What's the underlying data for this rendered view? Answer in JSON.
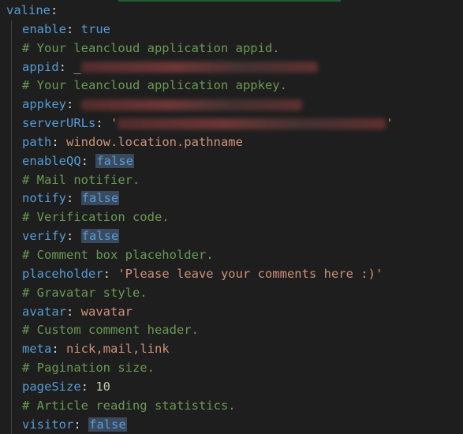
{
  "root_key": "valine",
  "lines": [
    {
      "kind": "kv",
      "key": "enable",
      "value": "true",
      "vtype": "bool"
    },
    {
      "kind": "comment",
      "text": "# Your leancloud application appid."
    },
    {
      "kind": "kv",
      "key": "appid",
      "value": "_",
      "vtype": "redacted"
    },
    {
      "kind": "comment",
      "text": "# Your leancloud application appkey."
    },
    {
      "kind": "kv",
      "key": "appkey",
      "value": "",
      "vtype": "redacted"
    },
    {
      "kind": "kv",
      "key": "serverURLs",
      "value": "''",
      "vtype": "redacted-string"
    },
    {
      "kind": "kv",
      "key": "path",
      "value": "window.location.pathname",
      "vtype": "string"
    },
    {
      "kind": "kv",
      "key": "enableQQ",
      "value": "false",
      "vtype": "bool-hl"
    },
    {
      "kind": "comment",
      "text": "# Mail notifier."
    },
    {
      "kind": "kv",
      "key": "notify",
      "value": "false",
      "vtype": "bool-hl"
    },
    {
      "kind": "comment",
      "text": "# Verification code."
    },
    {
      "kind": "kv",
      "key": "verify",
      "value": "false",
      "vtype": "bool-hl"
    },
    {
      "kind": "comment",
      "text": "# Comment box placeholder."
    },
    {
      "kind": "kv",
      "key": "placeholder",
      "value": "'Please leave your comments here :)'",
      "vtype": "string"
    },
    {
      "kind": "comment",
      "text": "# Gravatar style."
    },
    {
      "kind": "kv",
      "key": "avatar",
      "value": "wavatar",
      "vtype": "string"
    },
    {
      "kind": "comment",
      "text": "# Custom comment header."
    },
    {
      "kind": "kv",
      "key": "meta",
      "value": "nick,mail,link",
      "vtype": "string"
    },
    {
      "kind": "comment",
      "text": "# Pagination size."
    },
    {
      "kind": "kv",
      "key": "pageSize",
      "value": "10",
      "vtype": "number"
    },
    {
      "kind": "comment",
      "text": "# Article reading statistics."
    },
    {
      "kind": "kv",
      "key": "visitor",
      "value": "false",
      "vtype": "bool-hl"
    }
  ],
  "colors": {
    "background": "#1e1e1e",
    "key": "#569cd6",
    "comment": "#6a9955",
    "string": "#ce9178",
    "number": "#b5cea8",
    "punctuation": "#d4d4d4",
    "highlight_bg": "#3a4a5c",
    "redacted_blur": "#7a3a3a"
  }
}
